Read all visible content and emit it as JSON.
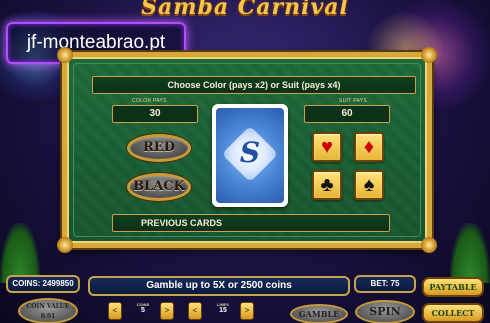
{
  "game": {
    "title": "Samba Carnival"
  },
  "watermark": {
    "text": "jf-monteabrao.pt"
  },
  "gamble": {
    "header": "Choose Color (pays x2) or Suit (pays x4)",
    "color_pays_label": "COLOR PAYS",
    "color_pays_value": "30",
    "suit_pays_label": "SUIT PAYS",
    "suit_pays_value": "60",
    "red_label": "RED",
    "black_label": "BLACK",
    "card_letter": "S",
    "suits": {
      "hearts": "♥",
      "diamonds": "♦",
      "clubs": "♣",
      "spades": "♠"
    },
    "previous_cards_label": "PREVIOUS CARDS"
  },
  "hud": {
    "coins": "COINS: 2499850",
    "message": "Gamble up to 5X or 2500 coins",
    "bet": "BET: 75",
    "paytable_label": "PAYTABLE",
    "collect_label": "COLLECT",
    "coin_value_label": "COIN VALUE",
    "coin_value": "0.01",
    "coins_label": "COINS",
    "coins_value": "5",
    "lines_label": "LINES",
    "lines_value": "15",
    "gamble_label": "GAMBLE",
    "spin_label": "SPIN",
    "arrow_left": "<",
    "arrow_right": ">"
  },
  "colors": {
    "panel_green": "#1f6a3a",
    "frame_gold": "#d6a93a",
    "card_blue": "#4a86d6",
    "watermark_border": "#b44cff"
  }
}
